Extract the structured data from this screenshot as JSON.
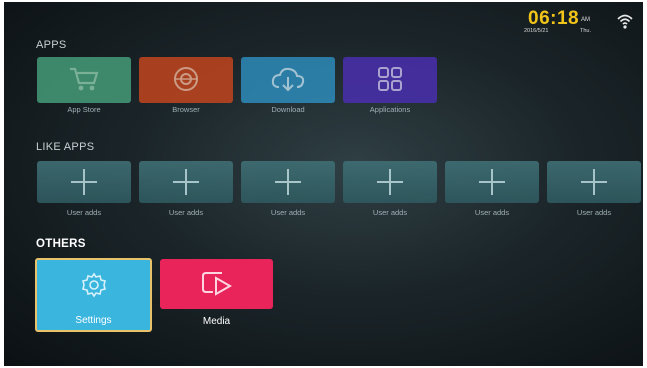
{
  "status": {
    "time": "06:18",
    "ampm": "AM",
    "date": "2016/5/21",
    "weekday": "Thu."
  },
  "sections": {
    "apps": {
      "label": "APPS"
    },
    "like_apps": {
      "label": "LIKE APPS"
    },
    "others": {
      "label": "OTHERS"
    }
  },
  "apps": [
    {
      "label": "App Store",
      "color": "#47a07c",
      "icon": "cart-icon"
    },
    {
      "label": "Browser",
      "color": "#c8471f",
      "icon": "globe-icon"
    },
    {
      "label": "Download",
      "color": "#2e8fbf",
      "icon": "cloud-download-icon"
    },
    {
      "label": "Applications",
      "color": "#4b2fb3",
      "icon": "grid-icon"
    }
  ],
  "like_apps": [
    {
      "label": "User adds"
    },
    {
      "label": "User adds"
    },
    {
      "label": "User adds"
    },
    {
      "label": "User adds"
    },
    {
      "label": "User adds"
    },
    {
      "label": "User adds"
    }
  ],
  "others": [
    {
      "label": "Settings",
      "color": "#3ab5de",
      "icon": "gear-icon",
      "selected": true
    },
    {
      "label": "Media",
      "color": "#e8245a",
      "icon": "play-screen-icon"
    }
  ]
}
